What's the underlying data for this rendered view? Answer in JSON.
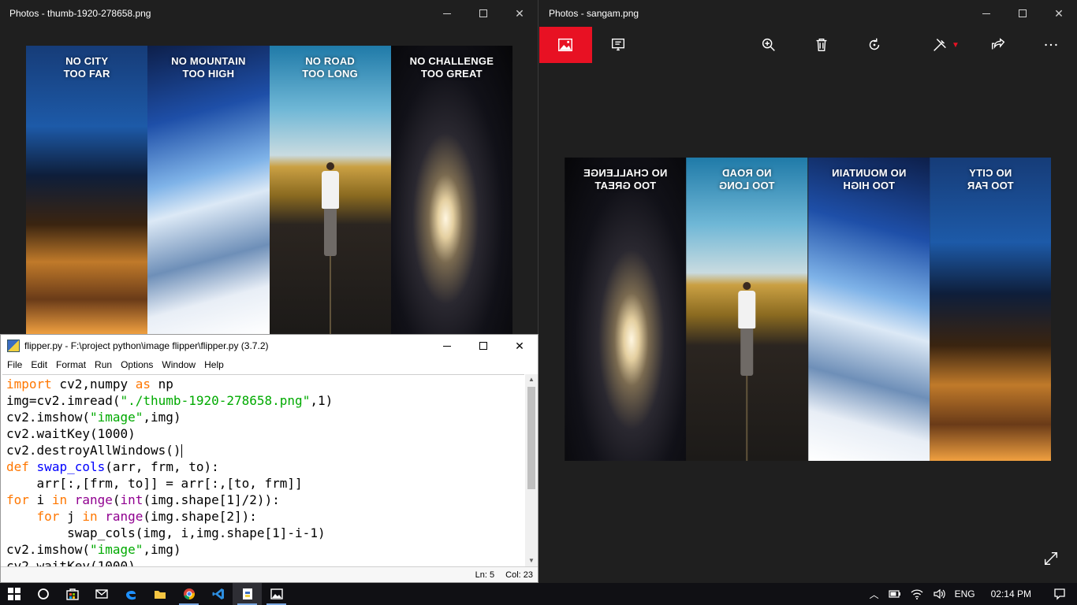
{
  "left_window": {
    "title": "Photos - thumb-1920-278658.png",
    "panels": [
      {
        "line1": "NO CITY",
        "line2": "TOO FAR"
      },
      {
        "line1": "NO MOUNTAIN",
        "line2": "TOO HIGH"
      },
      {
        "line1": "NO ROAD",
        "line2": "TOO LONG"
      },
      {
        "line1": "NO CHALLENGE",
        "line2": "TOO GREAT"
      }
    ]
  },
  "idle_window": {
    "title": "flipper.py - F:\\project python\\image flipper\\flipper.py (3.7.2)",
    "menu": [
      "File",
      "Edit",
      "Format",
      "Run",
      "Options",
      "Window",
      "Help"
    ],
    "status": {
      "line": "Ln: 5",
      "col": "Col: 23"
    }
  },
  "right_window": {
    "title": "Photos - sangam.png",
    "panels": [
      {
        "line1": "NO CHALLENGE",
        "line2": "TOO GREAT"
      },
      {
        "line1": "NO ROAD",
        "line2": "TOO LONG"
      },
      {
        "line1": "NO MOUNTAIN",
        "line2": "TOO HIGH"
      },
      {
        "line1": "NO CITY",
        "line2": "TOO FAR"
      }
    ],
    "toolbar": [
      "image-icon",
      "slideshow-icon",
      "zoom-icon",
      "delete-icon",
      "rotate-icon",
      "edit-draw-icon",
      "share-icon",
      "more-icon"
    ],
    "accent": "#e81123"
  },
  "taskbar": {
    "language": "ENG",
    "time": "02:14 PM"
  }
}
